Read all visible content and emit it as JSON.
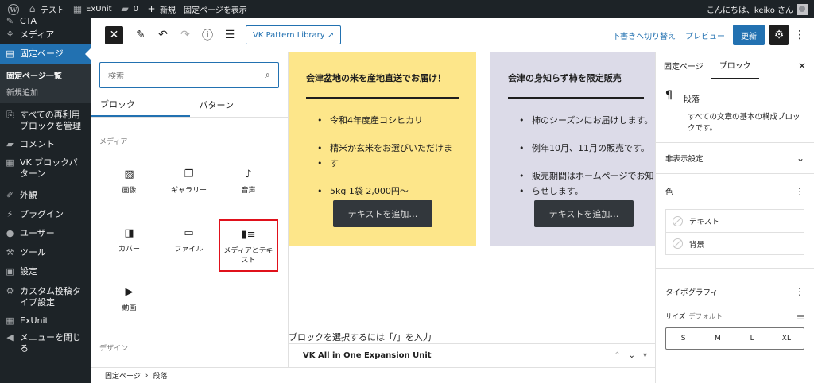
{
  "admin_bar": {
    "site_name": "テスト",
    "exunit": "ExUnit",
    "comments_count": "0",
    "new_label": "新規",
    "view_page": "固定ページを表示",
    "greeting": "こんにちは、keiko さん"
  },
  "sidebar": {
    "items": [
      {
        "label": "CTA",
        "icon": "cta-icon"
      },
      {
        "label": "メディア",
        "icon": "media-icon"
      },
      {
        "label": "固定ページ",
        "icon": "pages-icon"
      }
    ],
    "submenu": [
      "固定ページ一覧",
      "新規追加"
    ],
    "items_after": [
      {
        "label": "すべての再利用ブロックを管理",
        "icon": "reusable-icon"
      },
      {
        "label": "コメント",
        "icon": "comment-icon"
      },
      {
        "label": "VK ブロックパターン",
        "icon": "grid-icon"
      },
      {
        "label": "外観",
        "icon": "brush-icon"
      },
      {
        "label": "プラグイン",
        "icon": "plugin-icon"
      },
      {
        "label": "ユーザー",
        "icon": "user-icon"
      },
      {
        "label": "ツール",
        "icon": "wrench-icon"
      },
      {
        "label": "設定",
        "icon": "settings-icon"
      },
      {
        "label": "カスタム投稿タイプ設定",
        "icon": "gear-icon"
      },
      {
        "label": "ExUnit",
        "icon": "exunit-icon"
      },
      {
        "label": "メニューを閉じる",
        "icon": "collapse-icon"
      }
    ]
  },
  "header": {
    "pattern_library": "VK Pattern Library",
    "switch_to_draft": "下書きへ切り替え",
    "preview": "プレビュー",
    "update": "更新"
  },
  "inserter": {
    "search_placeholder": "検索",
    "tabs": [
      "ブロック",
      "パターン"
    ],
    "category_media": "メディア",
    "category_design": "デザイン",
    "blocks": [
      {
        "label": "画像",
        "icon": "image-icon",
        "glyph": "▨"
      },
      {
        "label": "ギャラリー",
        "icon": "gallery-icon",
        "glyph": "❐"
      },
      {
        "label": "音声",
        "icon": "audio-icon",
        "glyph": "♪"
      },
      {
        "label": "カバー",
        "icon": "cover-icon",
        "glyph": "◨"
      },
      {
        "label": "ファイル",
        "icon": "file-icon",
        "glyph": "▭"
      },
      {
        "label": "メディアとテキスト",
        "icon": "media-text-icon",
        "glyph": "▮≡"
      },
      {
        "label": "動画",
        "icon": "video-icon",
        "glyph": "▶"
      }
    ]
  },
  "canvas": {
    "card1": {
      "title": "会津盆地の米を産地直送でお届け！",
      "items": [
        "令和4年度産コシヒカリ",
        "精米か玄米をお選びいただけま",
        "す",
        "5kg 1袋 2,000円〜"
      ],
      "button": "テキストを追加…"
    },
    "card2": {
      "title": "会津の身知らず柿を限定販売",
      "items": [
        "柿のシーズンにお届けします。",
        "例年10月、11月の販売です。",
        "販売期間はホームページでお知",
        "らせします。"
      ],
      "button": "テキストを追加…"
    },
    "hint": "ブロックを選択するには「/」を入力",
    "meta_box_title": "VK All in One Expansion Unit"
  },
  "breadcrumb": [
    "固定ページ",
    "段落"
  ],
  "settings": {
    "tabs": [
      "固定ページ",
      "ブロック"
    ],
    "block_name": "段落",
    "block_desc": "すべての文章の基本の構成ブロックです。",
    "hidden_settings": "非表示設定",
    "color": "色",
    "color_text": "テキスト",
    "color_bg": "背景",
    "typography": "タイポグラフィ",
    "size_label": "サイズ",
    "size_default": "デフォルト",
    "sizes": [
      "S",
      "M",
      "L",
      "XL"
    ]
  },
  "colors": {
    "admin_dark": "#1d2327",
    "accent": "#2271b1",
    "card_yellow": "#fde68a",
    "card_purple": "#dcdbe8",
    "highlight_red": "#e0111b"
  }
}
